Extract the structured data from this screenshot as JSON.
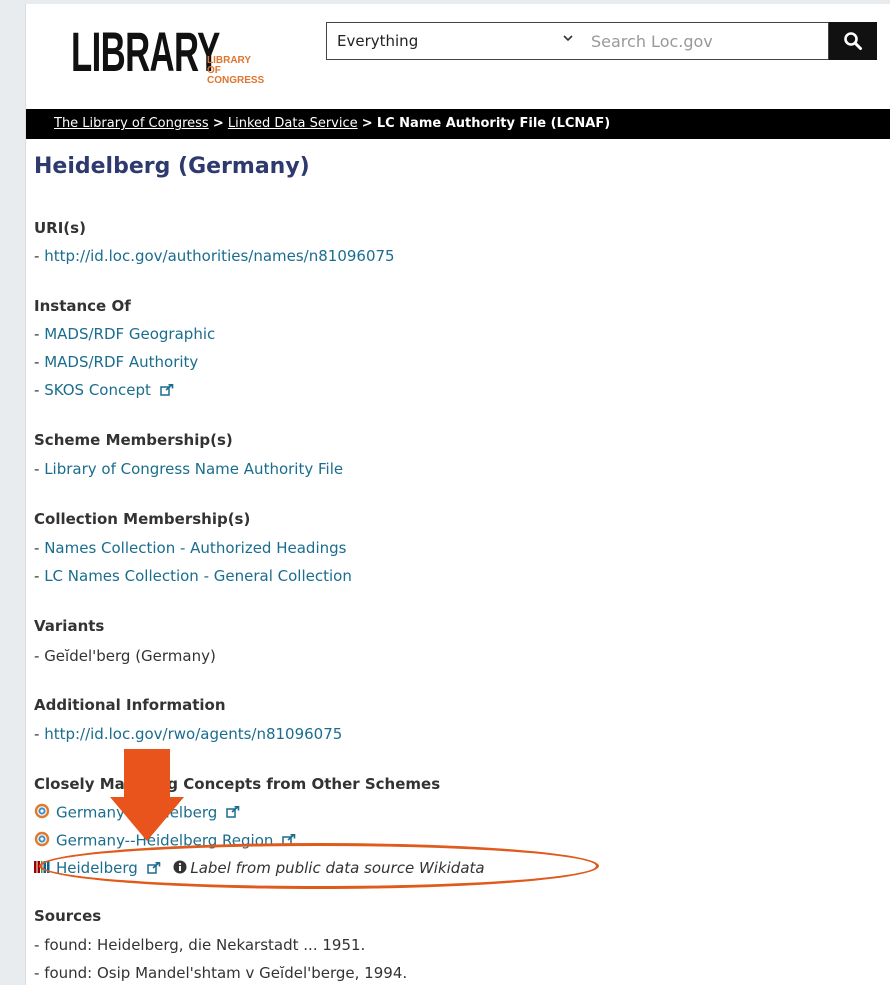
{
  "header": {
    "logo_main": "LIBRARY",
    "logo_sub": "LIBRARY\nOF CONGRESS",
    "scope_value": "Everything",
    "search_placeholder": "Search Loc.gov"
  },
  "breadcrumb": {
    "items": [
      "The Library of Congress",
      "Linked Data Service"
    ],
    "separator": ">",
    "current": "LC Name Authority File (LCNAF)"
  },
  "page": {
    "title": "Heidelberg (Germany)"
  },
  "sections": {
    "uri": {
      "label": "URI(s)",
      "items": [
        "http://id.loc.gov/authorities/names/n81096075"
      ]
    },
    "instance_of": {
      "label": "Instance Of",
      "items": [
        "MADS/RDF Geographic",
        "MADS/RDF Authority",
        "SKOS Concept"
      ]
    },
    "scheme": {
      "label": "Scheme Membership(s)",
      "items": [
        "Library of Congress Name Authority File"
      ]
    },
    "collection": {
      "label": "Collection Membership(s)",
      "items": [
        "Names Collection - Authorized Headings",
        "LC Names Collection - General Collection"
      ]
    },
    "variants": {
      "label": "Variants",
      "items": [
        "Geĭdel'berg (Germany)"
      ]
    },
    "additional": {
      "label": "Additional Information",
      "items": [
        "http://id.loc.gov/rwo/agents/n81096075"
      ]
    },
    "closely": {
      "label": "Closely Matching Concepts from Other Schemes",
      "items": [
        "Germany--Heidelberg",
        "Germany--Heidelberg Region",
        "Heidelberg"
      ],
      "note": "Label from public data source Wikidata"
    },
    "sources": {
      "label": "Sources",
      "items": [
        "found: Heidelberg, die Nekarstadt ... 1951.",
        "found: Osip Mandel'shtam v Geĭdel'berge, 1994."
      ]
    }
  },
  "bullet": "- ",
  "colors": {
    "link": "#1a6d8e",
    "title": "#2e3a6e",
    "annotation": "#e05a1c",
    "logo_accent": "#e0752e"
  },
  "icons": [
    "search-icon",
    "chevron-down-icon",
    "external-link-icon",
    "loc-scheme-icon",
    "wikidata-icon",
    "info-icon",
    "down-arrow-annotation"
  ]
}
